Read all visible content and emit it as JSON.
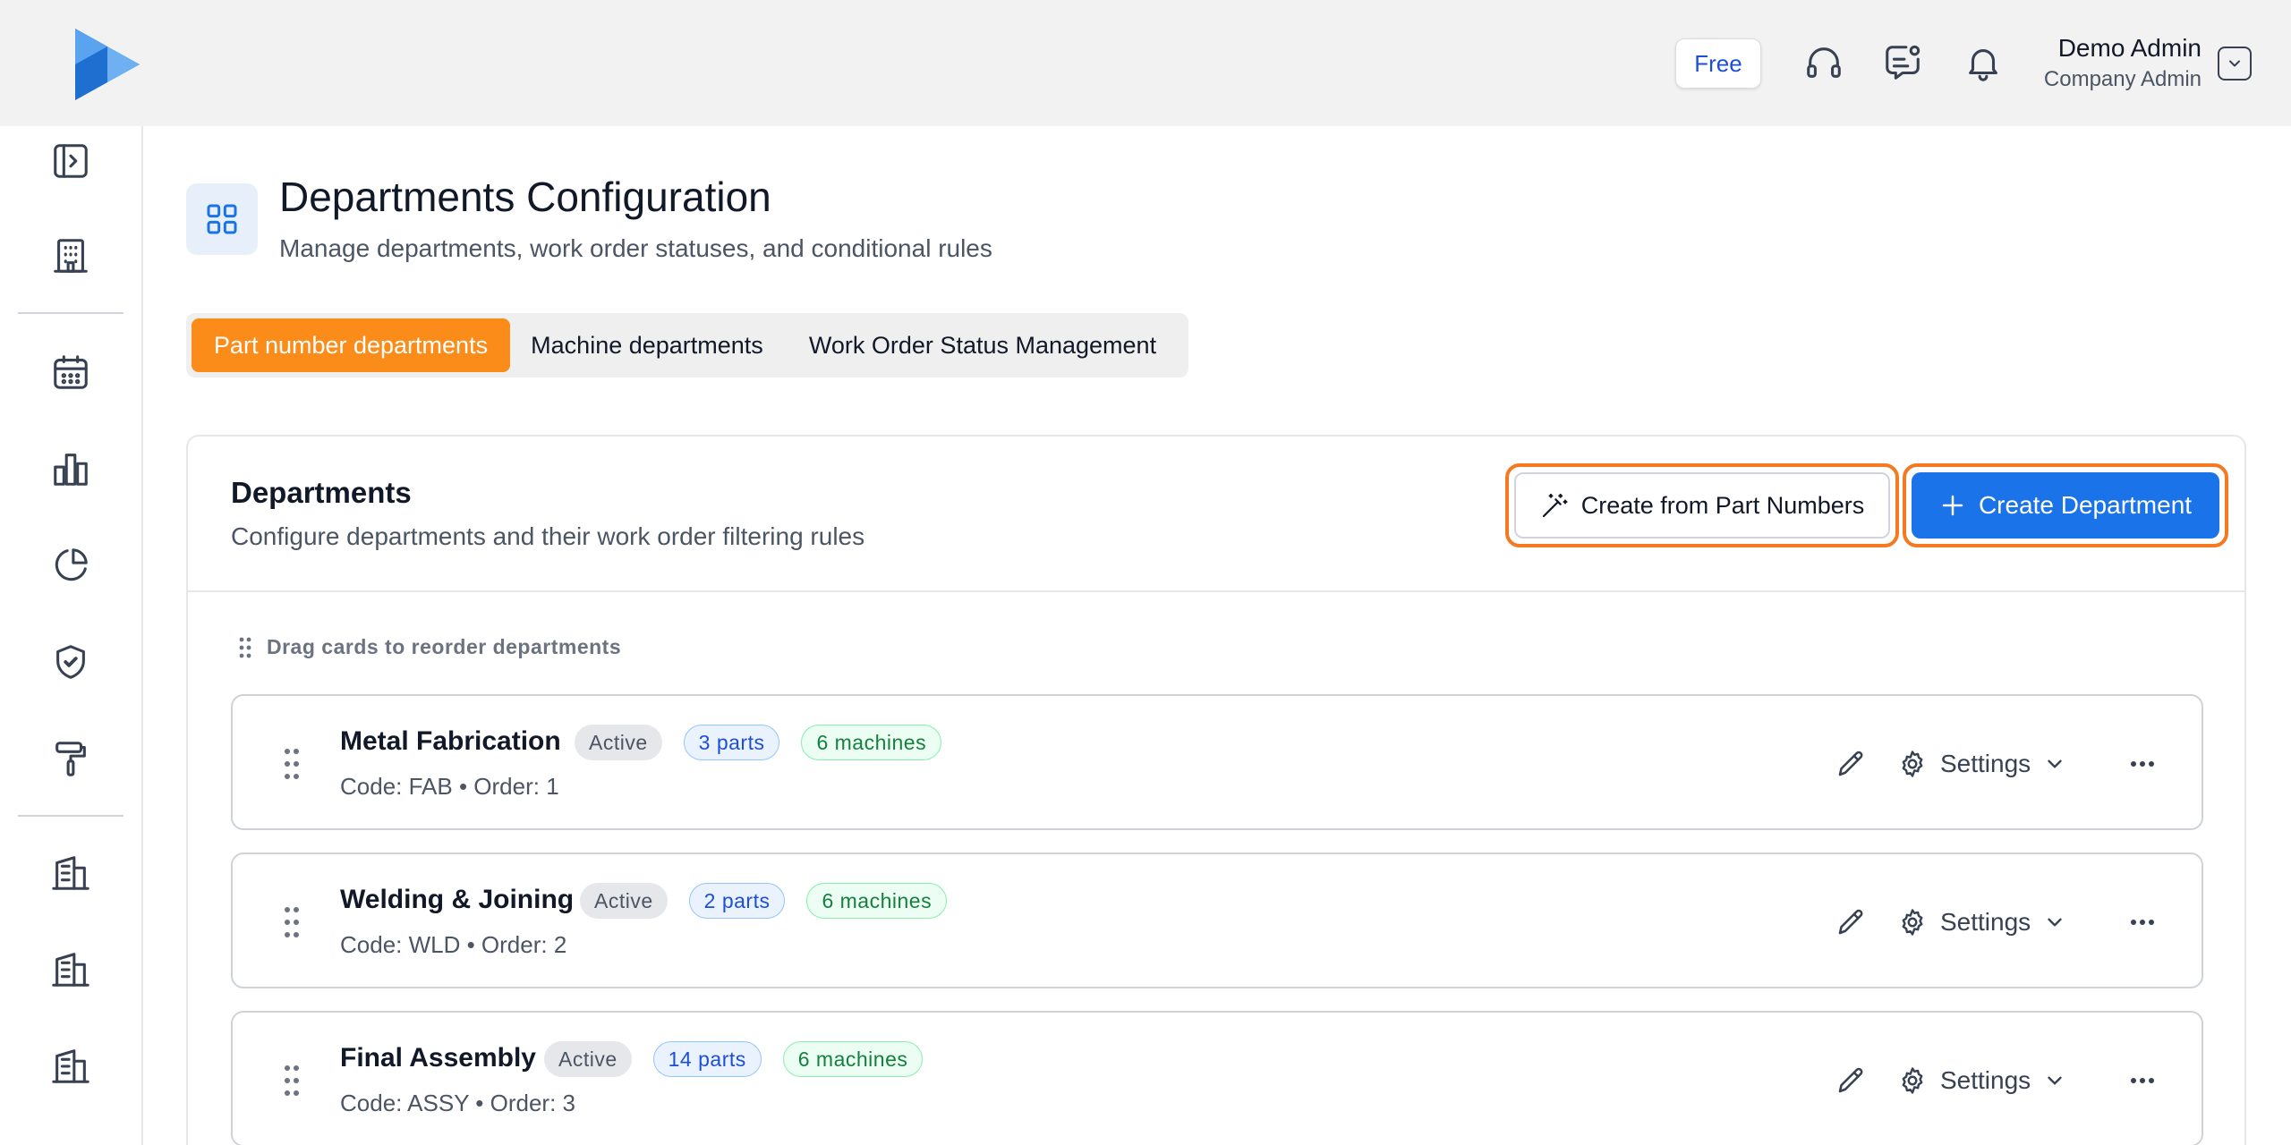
{
  "topbar": {
    "plan_badge": "Free",
    "icons": [
      "headset-icon",
      "message-icon",
      "bell-icon"
    ],
    "user": {
      "name": "Demo Admin",
      "role": "Company Admin"
    }
  },
  "sidebar": {
    "icons": [
      "sidebar-toggle-icon",
      "building-icon",
      "calendar-icon",
      "bar-chart-icon",
      "pie-chart-icon",
      "shield-check-icon",
      "paint-roller-icon",
      "office-building-icon",
      "office-building-icon",
      "office-building-icon"
    ]
  },
  "header": {
    "title": "Departments Configuration",
    "subtitle": "Manage departments, work order statuses, and conditional rules"
  },
  "tabs": [
    {
      "label": "Part number departments",
      "active": true
    },
    {
      "label": "Machine departments",
      "active": false
    },
    {
      "label": "Work Order Status Management",
      "active": false
    }
  ],
  "panel": {
    "title": "Departments",
    "subtitle": "Configure departments and their work order filtering rules",
    "create_from_parts_label": "Create from Part Numbers",
    "create_department_label": "Create Department",
    "drag_hint": "Drag cards to reorder departments"
  },
  "departments": [
    {
      "name": "Metal Fabrication",
      "status": "Active",
      "parts": "3 parts",
      "machines": "6 machines",
      "meta": "Code: FAB • Order: 1",
      "settings_label": "Settings"
    },
    {
      "name": "Welding & Joining",
      "status": "Active",
      "parts": "2 parts",
      "machines": "6 machines",
      "meta": "Code: WLD • Order: 2",
      "settings_label": "Settings"
    },
    {
      "name": "Final Assembly",
      "status": "Active",
      "parts": "14 parts",
      "machines": "6 machines",
      "meta": "Code: ASSY • Order: 3",
      "settings_label": "Settings"
    }
  ],
  "colors": {
    "accent_orange": "#fb8c1a",
    "primary_blue": "#1a73e8",
    "highlight_ring": "#f47920"
  }
}
